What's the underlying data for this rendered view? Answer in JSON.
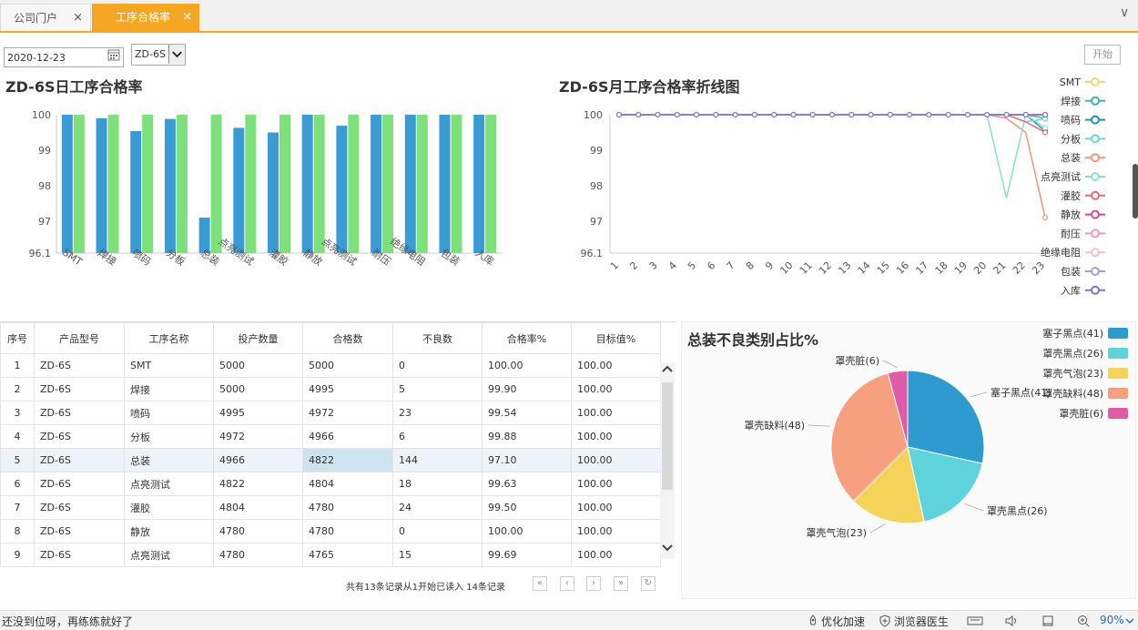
{
  "tabs": [
    {
      "label": "公司门户",
      "close": "×"
    },
    {
      "label": "工序合格率",
      "close": "×"
    }
  ],
  "menu_chevron": "∨",
  "toolbar": {
    "date": "2020-12-23",
    "model": "ZD-6S",
    "start": "开始"
  },
  "bar_chart": {
    "title": "ZD-6S日工序合格率"
  },
  "line_chart": {
    "title": "ZD-6S月工序合格率折线图"
  },
  "pie_chart": {
    "title": "总装不良类别占比%"
  },
  "chart_data": [
    {
      "type": "bar",
      "title": "ZD-6S日工序合格率",
      "categories": [
        "SMT",
        "焊接",
        "喷码",
        "分板",
        "总装",
        "点亮测试",
        "灌胶",
        "静放",
        "点亮测试",
        "耐压",
        "绝缘电阻",
        "包装",
        "入库"
      ],
      "ylim": [
        96.1,
        100
      ],
      "yticks": [
        "96.1",
        "97",
        "98",
        "99",
        "100"
      ],
      "series": [
        {
          "values": [
            100,
            99.9,
            99.54,
            99.88,
            97.1,
            99.63,
            99.5,
            100,
            99.69,
            100,
            100,
            100,
            100
          ],
          "color": "#3a9bd5"
        },
        {
          "values": [
            100,
            100,
            100,
            100,
            100,
            100,
            100,
            100,
            100,
            100,
            100,
            100,
            100
          ],
          "color": "#7ee07a"
        }
      ]
    },
    {
      "type": "line",
      "title": "ZD-6S月工序合格率折线图",
      "x": [
        "1",
        "2",
        "3",
        "4",
        "5",
        "6",
        "7",
        "8",
        "9",
        "10",
        "11",
        "12",
        "13",
        "14",
        "15",
        "16",
        "17",
        "18",
        "19",
        "20",
        "21",
        "22",
        "23"
      ],
      "ylim": [
        96.1,
        100
      ],
      "yticks": [
        "96.1",
        "97",
        "98",
        "99",
        "100"
      ],
      "series": [
        {
          "name": "SMT",
          "color": "#f5d76e",
          "values": [
            100,
            100,
            100,
            100,
            100,
            100,
            100,
            100,
            100,
            100,
            100,
            100,
            100,
            100,
            100,
            100,
            100,
            100,
            100,
            100,
            100,
            100,
            100
          ]
        },
        {
          "name": "焊接",
          "color": "#3bb3b3",
          "values": [
            100,
            100,
            100,
            100,
            100,
            100,
            100,
            100,
            100,
            100,
            100,
            100,
            100,
            100,
            100,
            100,
            100,
            100,
            100,
            100,
            100,
            100,
            99.9
          ]
        },
        {
          "name": "喷码",
          "color": "#2a8fa8",
          "values": [
            100,
            100,
            100,
            100,
            100,
            100,
            100,
            100,
            100,
            100,
            100,
            100,
            100,
            100,
            100,
            100,
            100,
            100,
            100,
            100,
            100,
            100,
            99.54
          ]
        },
        {
          "name": "分板",
          "color": "#6ad6d0",
          "values": [
            100,
            100,
            100,
            100,
            100,
            100,
            100,
            100,
            100,
            100,
            100,
            100,
            100,
            100,
            100,
            100,
            100,
            100,
            100,
            100,
            100,
            99.8,
            99.88
          ]
        },
        {
          "name": "总装",
          "color": "#f0957a",
          "values": [
            100,
            100,
            100,
            100,
            100,
            100,
            100,
            100,
            100,
            100,
            100,
            100,
            100,
            100,
            100,
            100,
            100,
            100,
            100,
            100,
            99.9,
            99.5,
            97.1
          ]
        },
        {
          "name": "点亮测试",
          "color": "#8fe0c0",
          "values": [
            100,
            100,
            100,
            100,
            100,
            100,
            100,
            100,
            100,
            100,
            100,
            100,
            100,
            100,
            100,
            100,
            100,
            100,
            100,
            100,
            97.65,
            100,
            99.63
          ]
        },
        {
          "name": "灌胶",
          "color": "#e06c7c",
          "values": [
            100,
            100,
            100,
            100,
            100,
            100,
            100,
            100,
            100,
            100,
            100,
            100,
            100,
            100,
            100,
            100,
            100,
            100,
            100,
            100,
            100,
            99.8,
            99.5
          ]
        },
        {
          "name": "静放",
          "color": "#d04a8a",
          "values": [
            100,
            100,
            100,
            100,
            100,
            100,
            100,
            100,
            100,
            100,
            100,
            100,
            100,
            100,
            100,
            100,
            100,
            100,
            100,
            100,
            100,
            100,
            100
          ]
        },
        {
          "name": "耐压",
          "color": "#e89ac0",
          "values": [
            100,
            100,
            100,
            100,
            100,
            100,
            100,
            100,
            100,
            100,
            100,
            100,
            100,
            100,
            100,
            100,
            100,
            100,
            100,
            100,
            100,
            100,
            100
          ]
        },
        {
          "name": "绝缘电阻",
          "color": "#f2c0d8",
          "values": [
            100,
            100,
            100,
            100,
            100,
            100,
            100,
            100,
            100,
            100,
            100,
            100,
            100,
            100,
            100,
            100,
            100,
            100,
            100,
            100,
            100,
            100,
            100
          ]
        },
        {
          "name": "包装",
          "color": "#a99ae0",
          "values": [
            100,
            100,
            100,
            100,
            100,
            100,
            100,
            100,
            100,
            100,
            100,
            100,
            100,
            100,
            100,
            100,
            100,
            100,
            100,
            100,
            100,
            100,
            100
          ]
        },
        {
          "name": "入库",
          "color": "#7d73c8",
          "values": [
            100,
            100,
            100,
            100,
            100,
            100,
            100,
            100,
            100,
            100,
            100,
            100,
            100,
            100,
            100,
            100,
            100,
            100,
            100,
            100,
            100,
            100,
            100
          ]
        }
      ]
    },
    {
      "type": "pie",
      "title": "总装不良类别占比%",
      "slices": [
        {
          "name": "塞子黑点",
          "value": 41,
          "label": "塞子黑点(41)",
          "color": "#2e9bd0"
        },
        {
          "name": "罩壳黑点",
          "value": 26,
          "label": "罩壳黑点(26)",
          "color": "#5fd3dc"
        },
        {
          "name": "罩壳气泡",
          "value": 23,
          "label": "罩壳气泡(23)",
          "color": "#f5d35a"
        },
        {
          "name": "罩壳缺料",
          "value": 48,
          "label": "罩壳缺料(48)",
          "color": "#f7a07f"
        },
        {
          "name": "罩壳脏",
          "value": 6,
          "label": "罩壳脏(6)",
          "color": "#e05ca8"
        }
      ]
    }
  ],
  "table": {
    "headers": [
      "序号",
      "产品型号",
      "工序名称",
      "投产数量",
      "合格数",
      "不良数",
      "合格率%",
      "目标值%"
    ],
    "rows": [
      [
        "1",
        "ZD-6S",
        "SMT",
        "5000",
        "5000",
        "0",
        "100.00",
        "100.00"
      ],
      [
        "2",
        "ZD-6S",
        "焊接",
        "5000",
        "4995",
        "5",
        "99.90",
        "100.00"
      ],
      [
        "3",
        "ZD-6S",
        "喷码",
        "4995",
        "4972",
        "23",
        "99.54",
        "100.00"
      ],
      [
        "4",
        "ZD-6S",
        "分板",
        "4972",
        "4966",
        "6",
        "99.88",
        "100.00"
      ],
      [
        "5",
        "ZD-6S",
        "总装",
        "4966",
        "4822",
        "144",
        "97.10",
        "100.00"
      ],
      [
        "6",
        "ZD-6S",
        "点亮测试",
        "4822",
        "4804",
        "18",
        "99.63",
        "100.00"
      ],
      [
        "7",
        "ZD-6S",
        "灌胶",
        "4804",
        "4780",
        "24",
        "99.50",
        "100.00"
      ],
      [
        "8",
        "ZD-6S",
        "静放",
        "4780",
        "4780",
        "0",
        "100.00",
        "100.00"
      ],
      [
        "9",
        "ZD-6S",
        "点亮测试",
        "4780",
        "4765",
        "15",
        "99.69",
        "100.00"
      ]
    ]
  },
  "pager": {
    "text": "共有13条记录从1开始已读入 14条记录",
    "buttons": [
      "«",
      "‹",
      "›",
      "»",
      "↻"
    ]
  },
  "statusbar": {
    "left": "还没到位呀，再练练就好了",
    "speedup": "优化加速",
    "doctor": "浏览器医生",
    "zoom": "90%"
  }
}
